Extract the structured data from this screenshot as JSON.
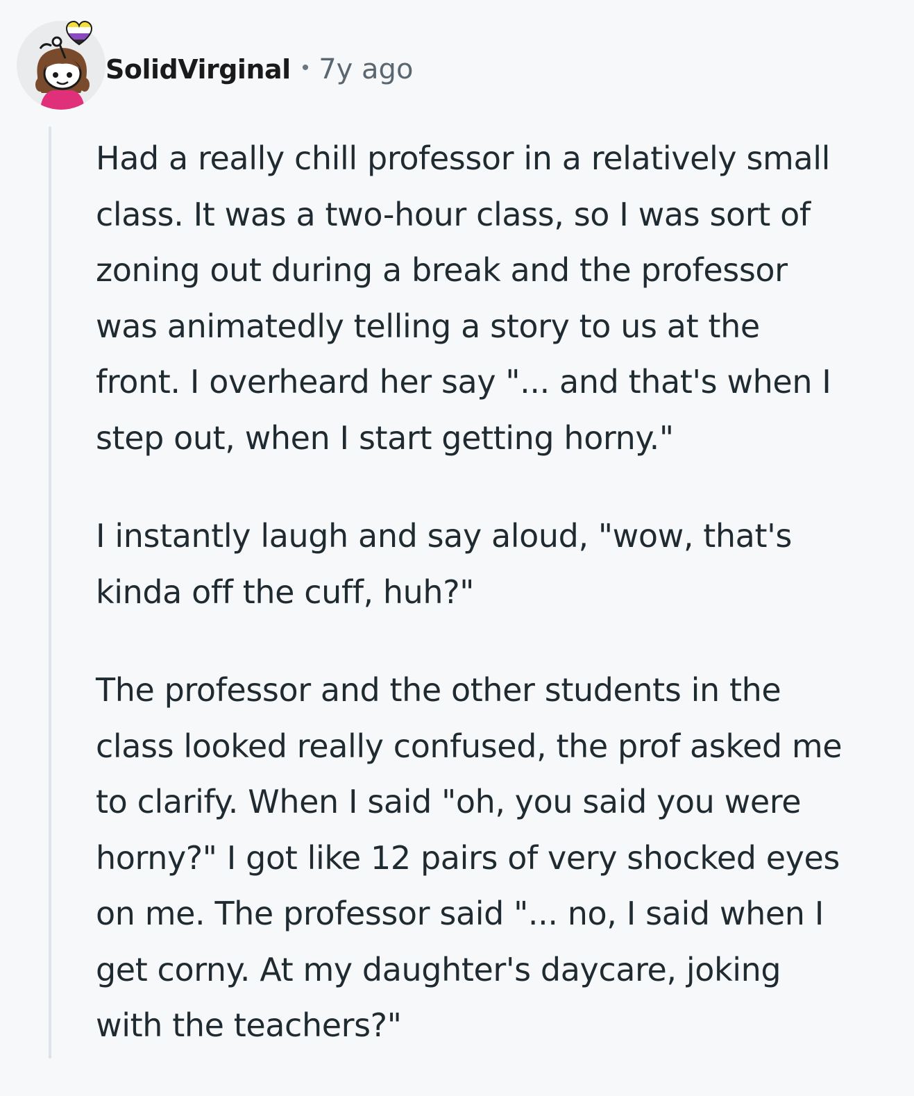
{
  "comment": {
    "author": "SolidVirginal",
    "separator": "•",
    "timestamp": "7y ago",
    "avatar_icon": "snoo-avatar-icon",
    "flair_icon": "nonbinary-heart-icon",
    "paragraphs": [
      "Had a really chill professor in a relatively small\nclass. It was a two-hour class, so I was sort of\nzoning out during a break and the professor\nwas animatedly telling a story to us at the\nfront. I overheard her say \"... and that's when I\nstep out, when I start getting horny.\"",
      "I instantly laugh and say aloud, \"wow, that's\nkinda off the cuff, huh?\"",
      "The professor and the other students in the\nclass looked really confused, the prof asked me\nto clarify. When I said \"oh, you said you were\nhorny?\" I got like 12 pairs of very shocked eyes\non me. The professor said \"... no, I said when I\nget corny. At my daughter's daycare, joking\nwith the teachers?\""
    ]
  },
  "colors": {
    "background": "#f6f8fa",
    "thread_line": "#dde3e8",
    "heart_yellow": "#f5dd3a",
    "heart_purple": "#8a4bbf",
    "shirt_pink": "#e0307a"
  }
}
